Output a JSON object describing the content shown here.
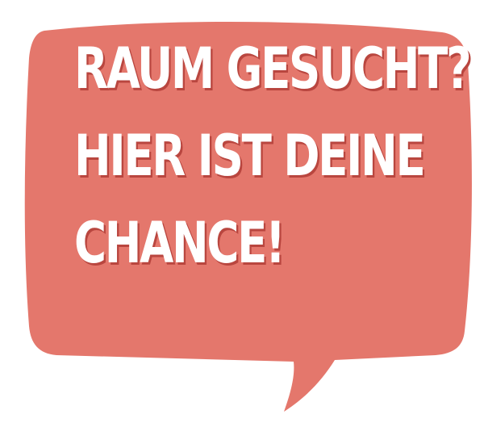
{
  "bubble": {
    "color": "#e4776c",
    "shadow_color": "#b9463f",
    "text_color": "#ffffff",
    "lines": [
      "Raum gesucht?",
      "Hier ist deine",
      "Chance!"
    ]
  }
}
